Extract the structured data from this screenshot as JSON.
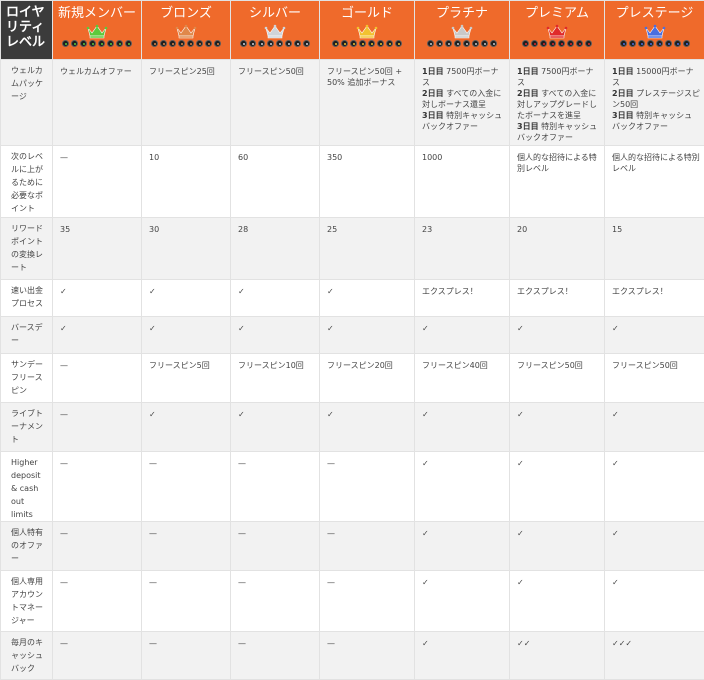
{
  "header": {
    "corner_label": "ロイヤリティレベル",
    "tiers": [
      {
        "name": "新規メンバー",
        "color": "#5cc93b"
      },
      {
        "name": "ブロンズ",
        "color": "#e0884a"
      },
      {
        "name": "シルバー",
        "color": "#cfd4da"
      },
      {
        "name": "ゴールド",
        "color": "#f2c230"
      },
      {
        "name": "プラチナ",
        "color": "#c9c9c9"
      },
      {
        "name": "プレミアム",
        "color": "#e02a2a"
      },
      {
        "name": "プレステージ",
        "color": "#4a6ee0"
      }
    ]
  },
  "rows": [
    {
      "label": "ウェルカムパッケージ",
      "height": 86,
      "alt": true,
      "cells": [
        "ウェルカムオファー",
        "フリースピン25回",
        "フリースピン50回",
        "フリースピン50回 + 50% 追加ボーナス",
        "<b>1日目</b> 7500円ボーナス<br><b>2日目</b> すべての入金に対しボーナス還呈<br><b>3日目</b> 特別キャッシュバックオファー",
        "<b>1日目</b> 7500円ボーナス<br><b>2日目</b> すべての入金に対しアップグレードしたボーナスを進呈<br><b>3日目</b> 特別キャッシュバックオファー",
        "<b>1日目</b> 15000円ボーナス<br><b>2日目</b> プレステージスピン50回<br><b>3日目</b> 特別キャッシュバックオファー"
      ]
    },
    {
      "label": "次のレベルに上がるために必要なポイント",
      "height": 72,
      "alt": false,
      "cells": [
        "—",
        "10",
        "60",
        "350",
        "1000",
        "個人的な招待による特別レベル",
        "個人的な招待による特別レベル"
      ]
    },
    {
      "label": "リワードポイントの変換レート",
      "height": 62,
      "alt": true,
      "cells": [
        "35",
        "30",
        "28",
        "25",
        "23",
        "20",
        "15"
      ]
    },
    {
      "label": "速い出金プロセス",
      "height": 37,
      "alt": false,
      "cells": [
        "✓",
        "✓",
        "✓",
        "✓",
        "エクスプレス！",
        "エクスプレス！",
        "エクスプレス！"
      ]
    },
    {
      "label": "バースデー",
      "height": 37,
      "alt": true,
      "cells": [
        "✓",
        "✓",
        "✓",
        "✓",
        "✓",
        "✓",
        "✓"
      ]
    },
    {
      "label": "サンデーフリースピン",
      "height": 49,
      "alt": false,
      "cells": [
        "—",
        "フリースピン5回",
        "フリースピン10回",
        "フリースピン20回",
        "フリースピン40回",
        "フリースピン50回",
        "フリースピン50回"
      ]
    },
    {
      "label": "ライブトーナメント",
      "height": 49,
      "alt": true,
      "cells": [
        "—",
        "✓",
        "✓",
        "✓",
        "✓",
        "✓",
        "✓"
      ]
    },
    {
      "label": "Higher deposit & cash out limits",
      "height": 62,
      "alt": false,
      "cells": [
        "—",
        "—",
        "—",
        "—",
        "✓",
        "✓",
        "✓"
      ]
    },
    {
      "label": "個人特有のオファー",
      "height": 49,
      "alt": true,
      "cells": [
        "—",
        "—",
        "—",
        "—",
        "✓",
        "✓",
        "✓"
      ]
    },
    {
      "label": "個人専用アカウントマネージャー",
      "height": 61,
      "alt": false,
      "cells": [
        "—",
        "—",
        "—",
        "—",
        "✓",
        "✓",
        "✓"
      ]
    },
    {
      "label": "毎月のキャッシュバック",
      "height": 48,
      "alt": true,
      "cells": [
        "—",
        "—",
        "—",
        "—",
        "✓",
        "✓✓",
        "✓✓✓"
      ]
    }
  ]
}
